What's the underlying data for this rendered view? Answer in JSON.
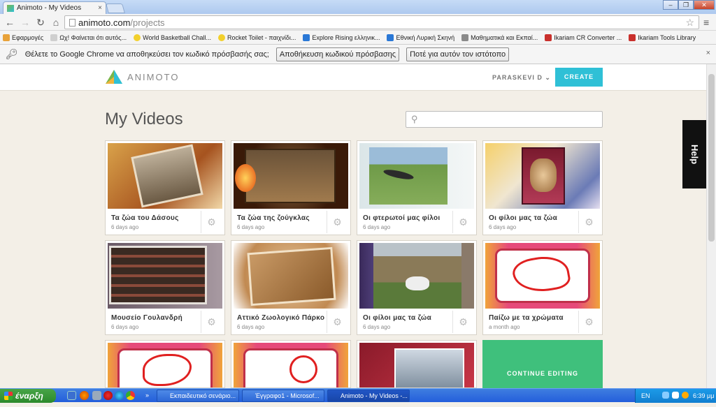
{
  "browser": {
    "tab_title": "Animoto - My Videos",
    "tab_close": "×",
    "url_host": "animoto.com",
    "url_path": "/projects",
    "star_icon": "star-icon",
    "bookmarks": [
      {
        "label": "Εφαρμογές",
        "color": "#e8a23a"
      },
      {
        "label": "Ωχ! Φαίνεται ότι αυτός...",
        "color": "#cfcfcf"
      },
      {
        "label": "World Basketball Chall...",
        "color": "#f2d02c"
      },
      {
        "label": "Rocket Toilet - παιχνίδι...",
        "color": "#f2d02c"
      },
      {
        "label": "Explore Rising ελληνικ...",
        "color": "#2a78d6"
      },
      {
        "label": "Εθνική Λυρική Σκηνή",
        "color": "#2a78d6"
      },
      {
        "label": "Μαθηματικά και Εκπαί...",
        "color": "#8a8a8a"
      },
      {
        "label": "Ikariam CR Converter ...",
        "color": "#c9302c"
      },
      {
        "label": "Ikariam Tools Library",
        "color": "#c9302c"
      }
    ],
    "infobar": {
      "message": "Θέλετε το Google Chrome να αποθηκεύσει τον κωδικό πρόσβασής σας;",
      "save_label": "Αποθήκευση κωδικού πρόσβασης",
      "never_label": "Ποτέ για αυτόν τον ιστότοπο",
      "close": "×"
    }
  },
  "header": {
    "logo_text": "ANIMOTO",
    "user_label": "PARASKEVI D",
    "create_label": "CREATE"
  },
  "page": {
    "title": "My Videos",
    "search_placeholder": "",
    "help_label": "Help"
  },
  "videos": [
    {
      "title": "Τα ζώα του Δάσους",
      "date": "6 days ago"
    },
    {
      "title": "Τα ζώα της ζούγκλας",
      "date": "6 days ago"
    },
    {
      "title": "Οι φτερωτοί μας φίλοι",
      "date": "6 days ago"
    },
    {
      "title": "Οι φίλοι μας τα ζώα",
      "date": "6 days ago"
    },
    {
      "title": "Μουσείο Γουλανδρή",
      "date": "6 days ago"
    },
    {
      "title": "Αττικό Ζωολογικό Πάρκο",
      "date": "6 days ago"
    },
    {
      "title": "Οι φίλοι μας τα ζώα",
      "date": "6 days ago"
    },
    {
      "title": "Παίζω με τα χρώματα",
      "date": "a month ago"
    }
  ],
  "continue_label": "CONTINUE EDITING",
  "taskbar": {
    "start_label": "έναρξη",
    "tasks": [
      {
        "label": "Εκπαιδευτικό σενάριο..."
      },
      {
        "label": "Έγγραφο1 - Microsof..."
      },
      {
        "label": "Animoto - My Videos -..."
      }
    ],
    "lang": "EN",
    "clock": "6:39 μμ"
  }
}
